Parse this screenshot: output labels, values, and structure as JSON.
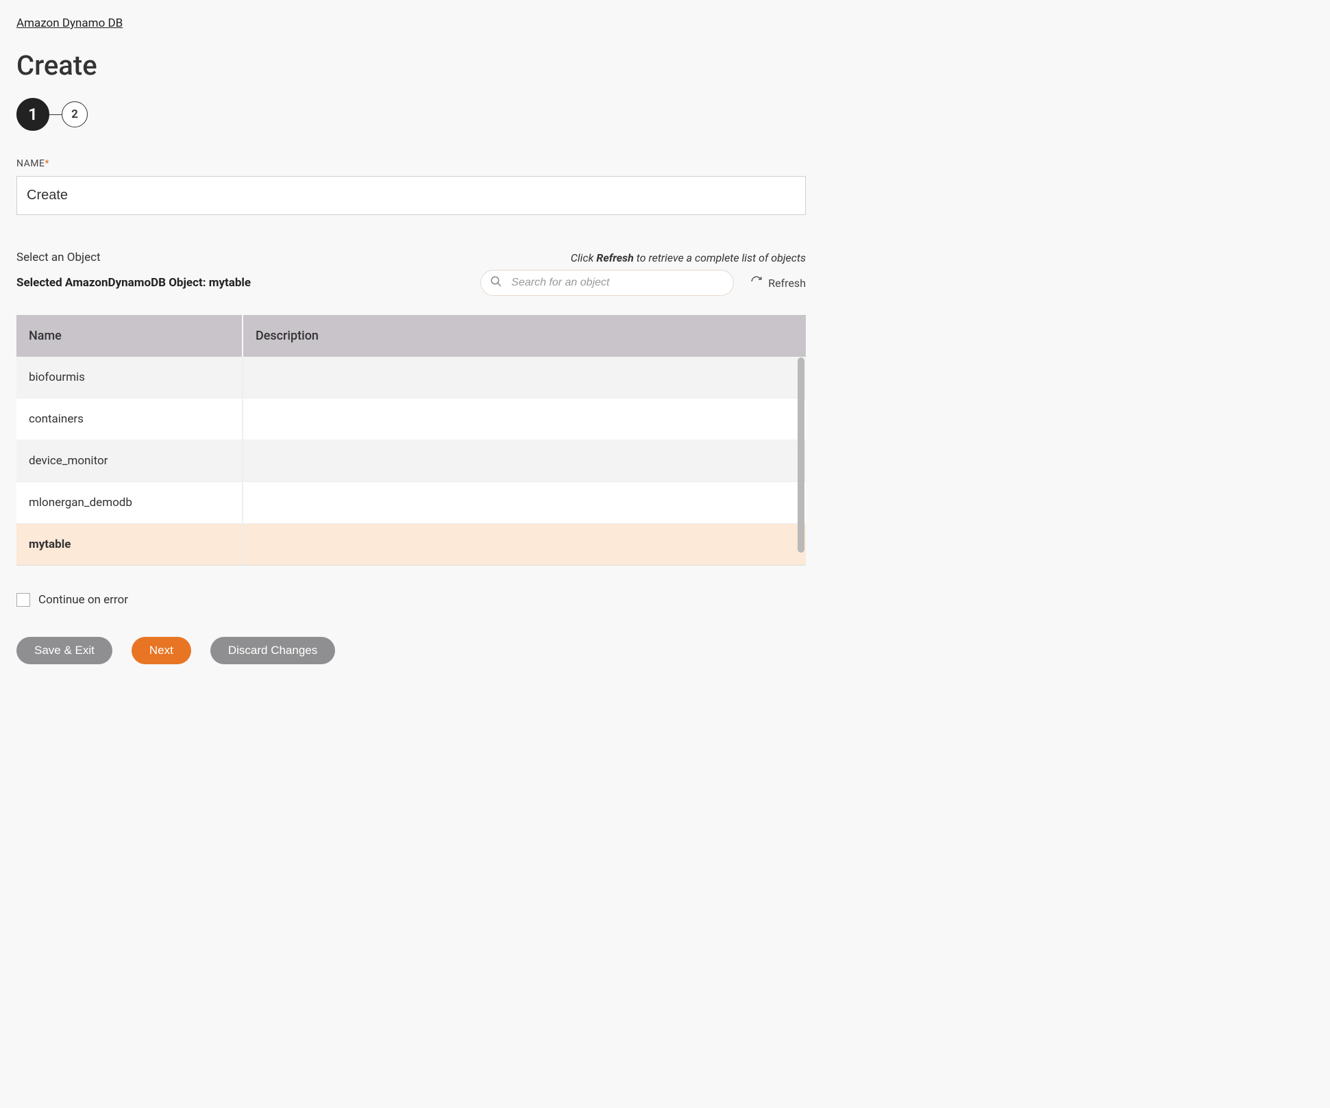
{
  "breadcrumb": "Amazon Dynamo DB",
  "page_title": "Create",
  "stepper": {
    "step1": "1",
    "step2": "2"
  },
  "name_field": {
    "label": "NAME",
    "required_mark": "*",
    "value": "Create"
  },
  "select_object": {
    "label": "Select an Object",
    "hint_pre": "Click ",
    "hint_bold": "Refresh",
    "hint_post": " to retrieve a complete list of objects",
    "selected_prefix": "Selected AmazonDynamoDB Object: ",
    "selected_value": "mytable",
    "search_placeholder": "Search for an object",
    "refresh_label": "Refresh"
  },
  "table": {
    "columns": [
      "Name",
      "Description"
    ],
    "rows": [
      {
        "name": "biofourmis",
        "description": "",
        "selected": false
      },
      {
        "name": "containers",
        "description": "",
        "selected": false
      },
      {
        "name": "device_monitor",
        "description": "",
        "selected": false
      },
      {
        "name": "mlonergan_demodb",
        "description": "",
        "selected": false
      },
      {
        "name": "mytable",
        "description": "",
        "selected": true
      }
    ]
  },
  "continue_on_error_label": "Continue on error",
  "buttons": {
    "save_exit": "Save & Exit",
    "next": "Next",
    "discard": "Discard Changes"
  }
}
